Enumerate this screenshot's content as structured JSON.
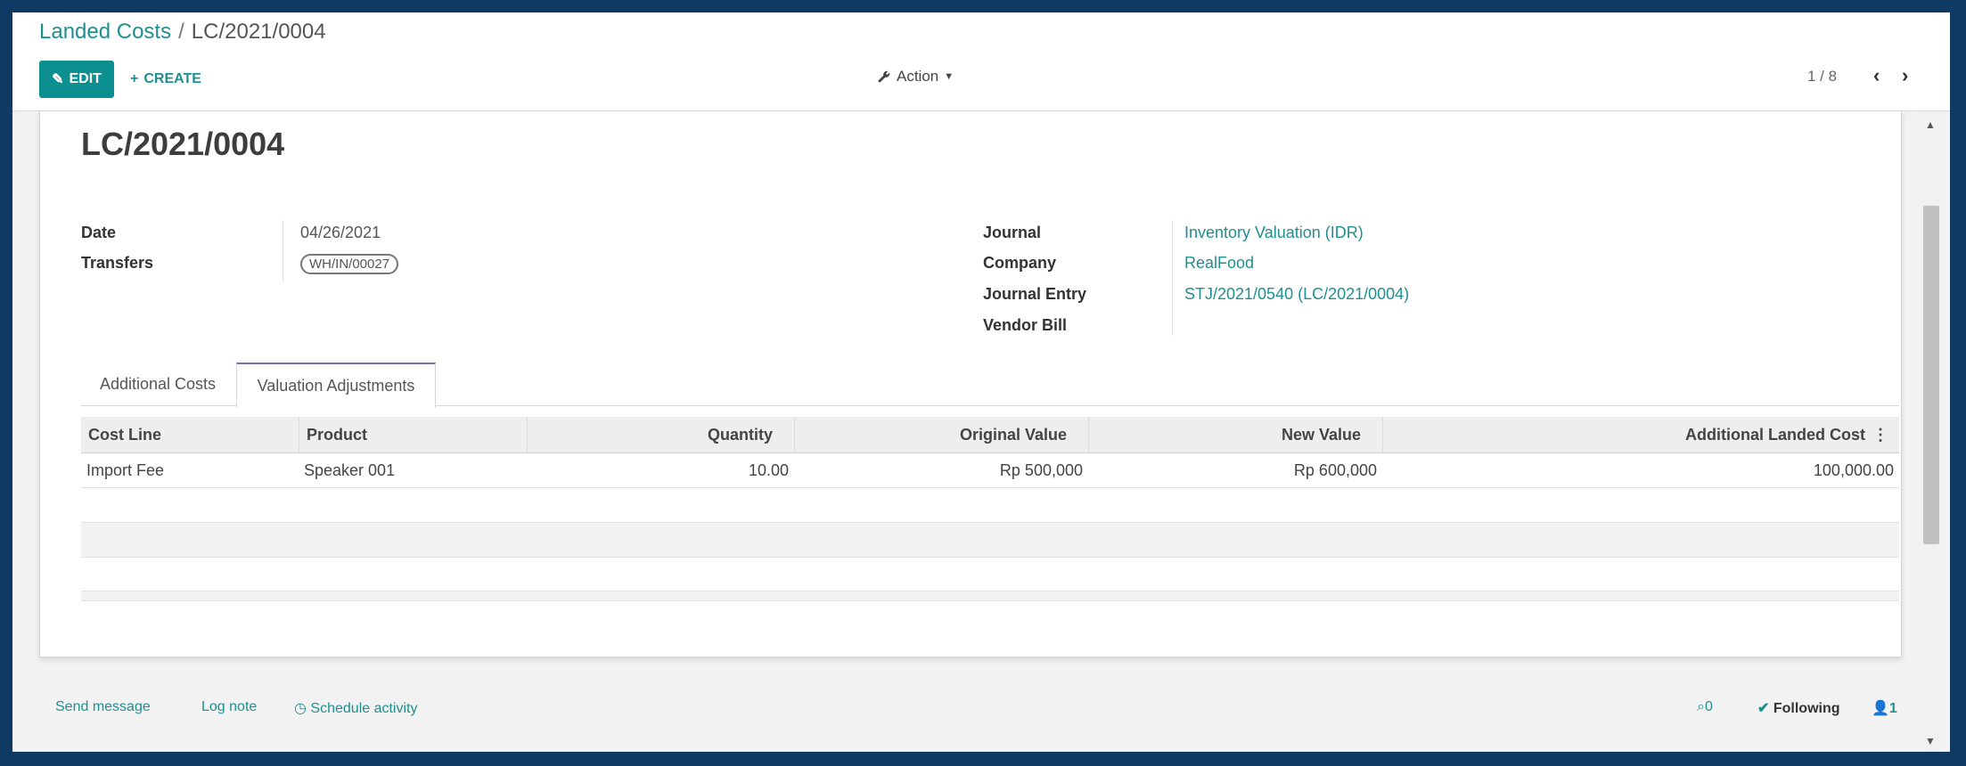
{
  "breadcrumb": {
    "root": "Landed Costs",
    "separator": "/",
    "current": "LC/2021/0004"
  },
  "toolbar": {
    "edit_label": "EDIT",
    "create_label": "CREATE",
    "action_label": "Action",
    "pager_text": "1 / 8"
  },
  "record": {
    "title": "LC/2021/0004",
    "left_fields": [
      {
        "label": "Date",
        "value": "04/26/2021"
      },
      {
        "label": "Transfers",
        "value": "WH/IN/00027"
      }
    ],
    "right_fields": [
      {
        "label": "Journal",
        "value": "Inventory Valuation (IDR)"
      },
      {
        "label": "Company",
        "value": "RealFood"
      },
      {
        "label": "Journal Entry",
        "value": "STJ/2021/0540 (LC/2021/0004)"
      },
      {
        "label": "Vendor Bill",
        "value": ""
      }
    ]
  },
  "tabs": [
    {
      "label": "Additional Costs",
      "active": false
    },
    {
      "label": "Valuation Adjustments",
      "active": true
    }
  ],
  "table": {
    "columns": [
      "Cost Line",
      "Product",
      "Quantity",
      "Original Value",
      "New Value",
      "Additional Landed Cost"
    ],
    "rows": [
      [
        "Import Fee",
        "Speaker 001",
        "10.00",
        "Rp 500,000",
        "Rp 600,000",
        "100,000.00"
      ]
    ]
  },
  "chatter": {
    "send_message": "Send message",
    "log_note": "Log note",
    "schedule_activity": "Schedule activity",
    "attachments_count": "0",
    "following_label": "Following",
    "followers_count": "1"
  },
  "colors": {
    "accent": "#0c8f8f",
    "link": "#1f8f8f",
    "frame": "#0e3a64",
    "tab_active_border": "#7a6fa6"
  },
  "icons": {
    "edit": "pencil-icon",
    "create": "plus-icon",
    "action": "wrench-icon",
    "prev": "chevron-left-icon",
    "next": "chevron-right-icon",
    "schedule": "clock-icon",
    "attachment": "paperclip-icon",
    "following": "check-icon",
    "followers": "user-icon",
    "column_options": "kebab-icon"
  }
}
